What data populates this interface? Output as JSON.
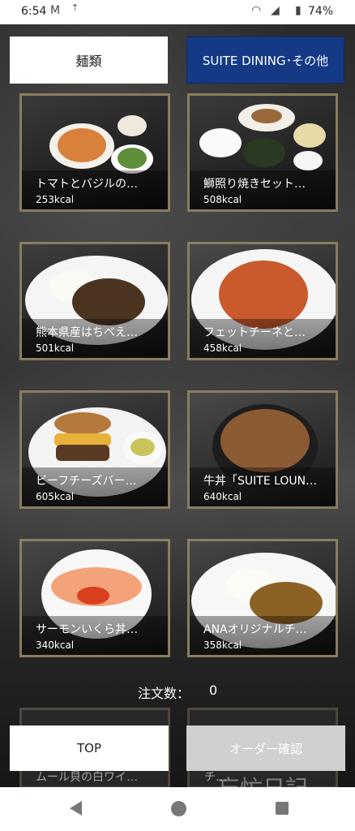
{
  "status_bar": {
    "time": "6:54",
    "battery": "74%",
    "icons": [
      "mail-icon",
      "data-saver-icon",
      "wifi-icon",
      "signal-icon",
      "battery-icon"
    ]
  },
  "tabs": [
    {
      "label": "麺類",
      "active": false
    },
    {
      "label": "SUITE DINING･その他",
      "active": true
    }
  ],
  "menu": [
    {
      "name": "トマトとバジルの…",
      "kcal": "253kcal"
    },
    {
      "name": "鰤照り焼きセット…",
      "kcal": "508kcal"
    },
    {
      "name": "熊本県産はちべえ…",
      "kcal": "501kcal"
    },
    {
      "name": "フェットチーネと…",
      "kcal": "458kcal"
    },
    {
      "name": "ビーフチーズバー…",
      "kcal": "605kcal"
    },
    {
      "name": "牛丼「SUITE LOUN…",
      "kcal": "640kcal"
    },
    {
      "name": "サーモンいくら丼…",
      "kcal": "340kcal"
    },
    {
      "name": "ANAオリジナルチ…",
      "kcal": "358kcal"
    }
  ],
  "partial_row": [
    "ムール貝の白ワイ…",
    "チ…"
  ],
  "order": {
    "label": "注文数：",
    "count": "0"
  },
  "buttons": {
    "top": "TOP",
    "confirm": "オーダー確認"
  },
  "watermark": "忘忙日記",
  "colors": {
    "accent_tab": "#143a86",
    "card_border": "#8a7d5e"
  }
}
